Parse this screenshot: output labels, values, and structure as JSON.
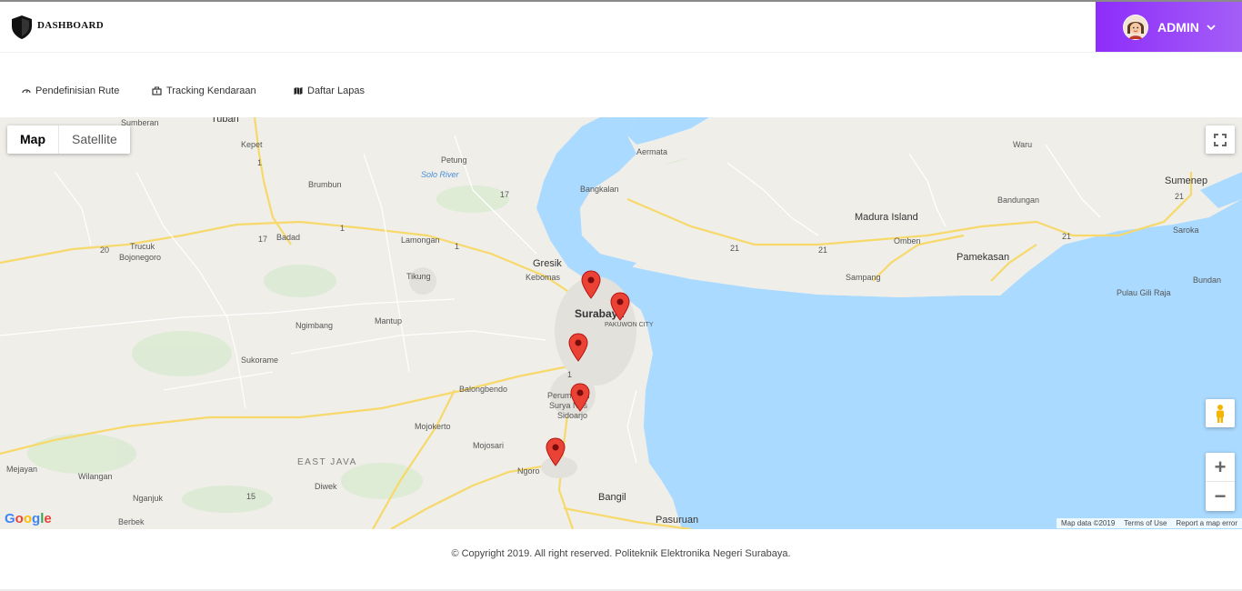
{
  "header": {
    "brand": "DASHBOARD",
    "logo_icon": "shield-icon",
    "user_label": "ADMIN",
    "accent_start": "#8e2dfa",
    "accent_end": "#a35ef7"
  },
  "nav": {
    "items": [
      {
        "label": "Pendefinisian Rute",
        "icon": "route-icon"
      },
      {
        "label": "Tracking Kendaraan",
        "icon": "vehicle-icon"
      },
      {
        "label": "Daftar Lapas",
        "icon": "map-icon"
      }
    ]
  },
  "map": {
    "type_buttons": [
      "Map",
      "Satellite"
    ],
    "active_type": "Map",
    "fullscreen_icon": "fullscreen-icon",
    "pegman_icon": "pegman-icon",
    "zoom_in_label": "+",
    "zoom_out_label": "−",
    "google_logo": "Google",
    "attribution": {
      "map_data": "Map data ©2019",
      "terms": "Terms of Use",
      "report": "Report a map error"
    },
    "places": {
      "tuban": "Tuban",
      "sumberan": "Sumberan",
      "kepet": "Kepet",
      "petung": "Petung",
      "brumbun": "Brumbun",
      "solo_river": "Solo River",
      "badad": "Badad",
      "lamongan": "Lamongan",
      "trucuk": "Trucuk",
      "bojonegoro": "Bojonegoro",
      "tikung": "Tikung",
      "ngimbang": "Ngimbang",
      "mantup": "Mantup",
      "sukorame": "Sukorame",
      "balongbendo": "Balongbendo",
      "mojokerto": "Mojokerto",
      "mojosari": "Mojosari",
      "ngoro": "Ngoro",
      "east_java": "EAST JAVA",
      "diwek": "Diwek",
      "mejayan": "Mejayan",
      "wilangan": "Wilangan",
      "nganjuk": "Nganjuk",
      "berbek": "Berbek",
      "bangil": "Bangil",
      "pasuruan": "Pasuruan",
      "gresik": "Gresik",
      "kebomas": "Kebomas",
      "surabaya": "Surabaya",
      "pakuwon": "PAKUWON CITY",
      "perumahan": "Perumahan",
      "surya": "Surya Nus",
      "sidoarjo": "Sidoarjo",
      "bangkalan": "Bangkalan",
      "aermata": "Aermata",
      "madura": "Madura Island",
      "omben": "Omben",
      "sampang": "Sampang",
      "pamekasan": "Pamekasan",
      "waru": "Waru",
      "bandungan": "Bandungan",
      "sumenep": "Sumenep",
      "saroka": "Saroka",
      "gili_raja": "Pulau Gili Raja",
      "bundan": "Bundan"
    },
    "shields": [
      "17",
      "1",
      "17",
      "1",
      "1",
      "20",
      "21",
      "21",
      "21",
      "21",
      "1",
      "15"
    ],
    "marker_color": "#ea4335",
    "water_color": "#aadaff"
  },
  "footer": {
    "copyright": "© Copyright 2019. All right reserved. Politeknik Elektronika Negeri Surabaya."
  }
}
